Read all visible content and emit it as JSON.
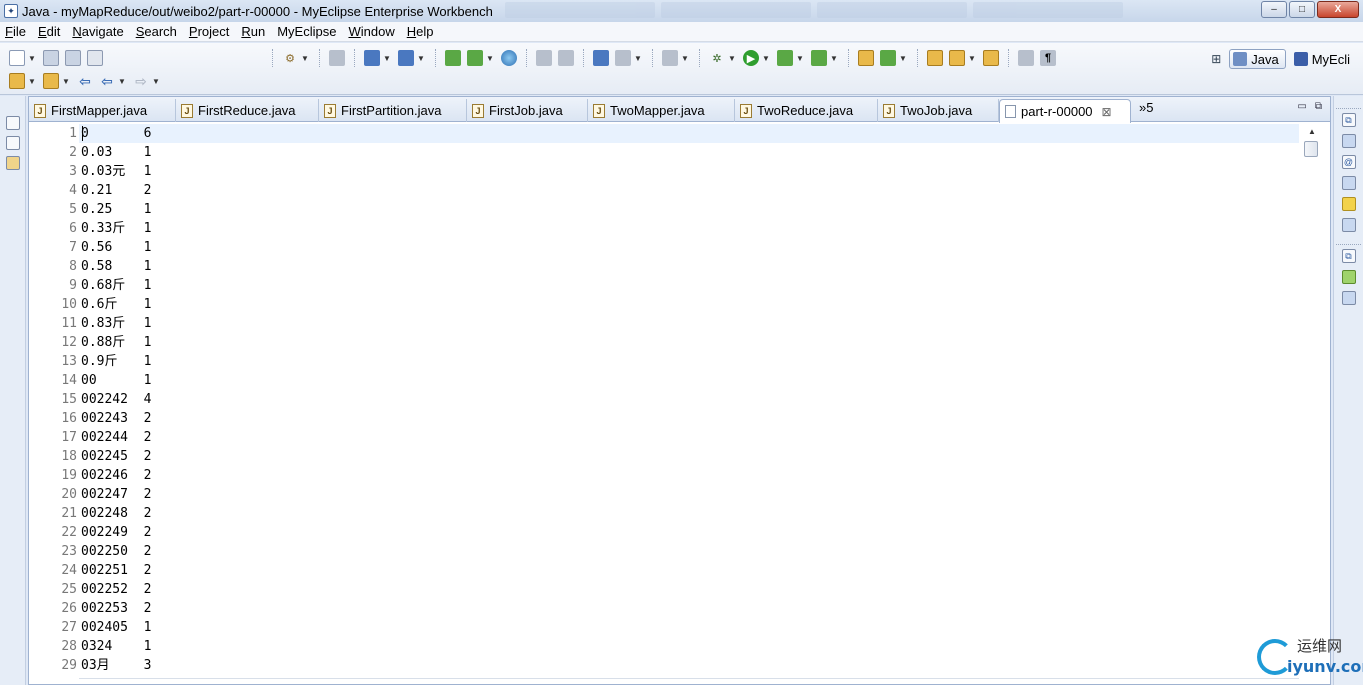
{
  "window": {
    "title": "Java - myMapReduce/out/weibo2/part-r-00000 - MyEclipse Enterprise Workbench",
    "min_glyph": "–",
    "max_glyph": "□",
    "close_glyph": "X"
  },
  "menu": [
    {
      "u": "F",
      "rest": "ile"
    },
    {
      "u": "E",
      "rest": "dit"
    },
    {
      "u": "N",
      "rest": "avigate"
    },
    {
      "u": "S",
      "rest": "earch"
    },
    {
      "u": "P",
      "rest": "roject"
    },
    {
      "u": "R",
      "rest": "un"
    },
    {
      "u": "",
      "rest": "MyEclipse"
    },
    {
      "u": "W",
      "rest": "indow"
    },
    {
      "u": "H",
      "rest": "elp"
    }
  ],
  "perspectives": {
    "java": "Java",
    "myeclipse": "MyEcli"
  },
  "tabs": [
    {
      "label": "FirstMapper.java"
    },
    {
      "label": "FirstReduce.java"
    },
    {
      "label": "FirstPartition.java"
    },
    {
      "label": "FirstJob.java"
    },
    {
      "label": "TwoMapper.java"
    },
    {
      "label": "TwoReduce.java"
    },
    {
      "label": "TwoJob.java"
    }
  ],
  "active_tab": {
    "label": "part-r-00000",
    "close": "⊠"
  },
  "tab_overflow": "»5",
  "lines": [
    {
      "n": "1",
      "text": "0\t6"
    },
    {
      "n": "2",
      "text": "0.03\t1"
    },
    {
      "n": "3",
      "text": "0.03元\t1"
    },
    {
      "n": "4",
      "text": "0.21\t2"
    },
    {
      "n": "5",
      "text": "0.25\t1"
    },
    {
      "n": "6",
      "text": "0.33斤\t1"
    },
    {
      "n": "7",
      "text": "0.56\t1"
    },
    {
      "n": "8",
      "text": "0.58\t1"
    },
    {
      "n": "9",
      "text": "0.68斤\t1"
    },
    {
      "n": "10",
      "text": "0.6斤\t1"
    },
    {
      "n": "11",
      "text": "0.83斤\t1"
    },
    {
      "n": "12",
      "text": "0.88斤\t1"
    },
    {
      "n": "13",
      "text": "0.9斤\t1"
    },
    {
      "n": "14",
      "text": "00\t1"
    },
    {
      "n": "15",
      "text": "002242\t4"
    },
    {
      "n": "16",
      "text": "002243\t2"
    },
    {
      "n": "17",
      "text": "002244\t2"
    },
    {
      "n": "18",
      "text": "002245\t2"
    },
    {
      "n": "19",
      "text": "002246\t2"
    },
    {
      "n": "20",
      "text": "002247\t2"
    },
    {
      "n": "21",
      "text": "002248\t2"
    },
    {
      "n": "22",
      "text": "002249\t2"
    },
    {
      "n": "23",
      "text": "002250\t2"
    },
    {
      "n": "24",
      "text": "002251\t2"
    },
    {
      "n": "25",
      "text": "002252\t2"
    },
    {
      "n": "26",
      "text": "002253\t2"
    },
    {
      "n": "27",
      "text": "002405\t1"
    },
    {
      "n": "28",
      "text": "0324\t1"
    },
    {
      "n": "29",
      "text": "03月\t3"
    }
  ],
  "watermark": {
    "cn": "运维网",
    "en": "iyunv.com"
  }
}
